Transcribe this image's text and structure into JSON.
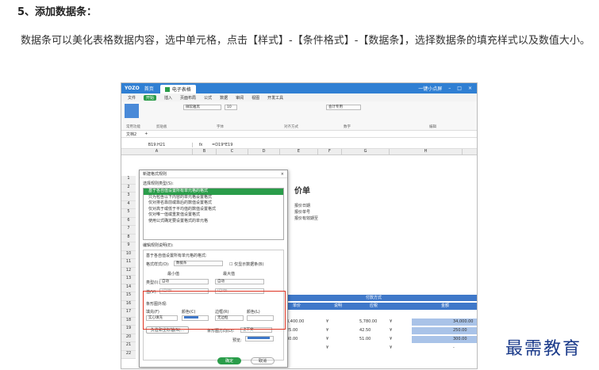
{
  "heading": "5、添加数据条：",
  "para": "数据条可以美化表格数据内容，选中单元格，点击【样式】-【条件格式】-【数据条】，选择数据条的填充样式以及数值大小。",
  "app": {
    "logo": "YOZO",
    "home": "首页",
    "tab": "电子表格",
    "user": "一键小点屏"
  },
  "menu": [
    "文件",
    "开始",
    "插入",
    "页面布局",
    "公式",
    "数据",
    "审阅",
    "视图",
    "开发工具"
  ],
  "ribbon_groups": [
    "常用功能",
    "剪贴板",
    "字体",
    "对齐方式",
    "数字",
    "编辑"
  ],
  "font": {
    "name": "微软雅黑",
    "size": "10",
    "number": "会计专用"
  },
  "doc_tab": "文档2",
  "cell_ref": "B19:H21",
  "fx": "fx",
  "formula": "=D19*E19",
  "columns": [
    "A",
    "B",
    "C",
    "D",
    "E",
    "F",
    "G",
    "H"
  ],
  "rows": [
    "1",
    "2",
    "3",
    "4",
    "5",
    "6",
    "7",
    "8",
    "9",
    "10",
    "11",
    "12",
    "13",
    "14",
    "15",
    "16",
    "17",
    "18",
    "19",
    "20",
    "21",
    "22"
  ],
  "sheet": {
    "title": "价单",
    "info1": "报价日期",
    "info2": "报价单号",
    "info3": "报价有效期至",
    "band_label": "付款方式",
    "hdr": [
      "单价",
      "说明",
      "应税",
      "金额"
    ],
    "rows": [
      [
        "3,400.00",
        "¥",
        "5,780.00",
        "¥",
        "34,000.00"
      ],
      [
        "25.00",
        "¥",
        "42.50",
        "¥",
        "250.00"
      ],
      [
        "30.00",
        "¥",
        "51.00",
        "¥",
        "300.00"
      ],
      [
        "",
        "¥",
        "",
        "¥",
        "-"
      ]
    ]
  },
  "dialog": {
    "title": "新建格式规则",
    "close": "×",
    "type_label": "选择规则类型(S):",
    "rules": [
      "基于各自值设置所有单元格的格式",
      "只为包含以下内容的单元格设置格式",
      "仅对排名靠前或靠后的数值设置格式",
      "仅对高于或低于平均值的数值设置格式",
      "仅对唯一值或重复值设置格式",
      "使用公式确定要设置格式的单元格"
    ],
    "edit_label": "编辑规则说明(E):",
    "based_label": "基于各自值设置所有单元格的格式:",
    "style_label": "格式样式(O):",
    "style_value": "数据条",
    "show_bar_only": "仅显示数据条(B)",
    "min": "最小值",
    "max": "最大值",
    "type": "类型(I):",
    "type_min": "自动",
    "type_max": "自动",
    "value": "值(V):",
    "value_min": "(自动)",
    "value_max": "(自动)",
    "appearance": "条形图外观:",
    "fill": "填充(F)",
    "color": "颜色(C)",
    "border": "边框(R)",
    "border_color": "颜色(L)",
    "fill_value": "实心填充",
    "border_value": "无边框",
    "negative": "负值和坐标轴(N)...",
    "direction": "条形图方向(D):",
    "direction_value": "上下文",
    "preview": "预览:",
    "ok": "确定",
    "cancel": "取消"
  },
  "watermark": "最需教育"
}
